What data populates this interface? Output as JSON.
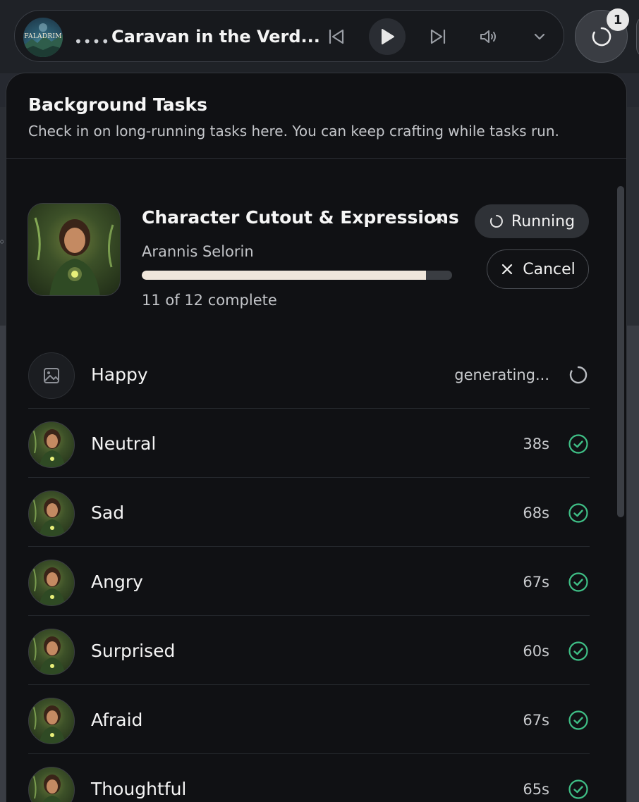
{
  "player": {
    "cover_label": "FALADRIM",
    "menu_dots": "••••",
    "track_title": "Caravan in the Verd...",
    "queue_count": "1"
  },
  "panel": {
    "title": "Background Tasks",
    "subtitle": "Check in on long-running tasks here. You can keep crafting while tasks run."
  },
  "task": {
    "title": "Character Cutout & Expressions",
    "owner": "Arannis Selorin",
    "completed": 11,
    "total": 12,
    "count_text": "11 of 12 complete",
    "status_label": "Running",
    "cancel_label": "Cancel"
  },
  "expressions": [
    {
      "name": "Happy",
      "time": "generating...",
      "state": "generating"
    },
    {
      "name": "Neutral",
      "time": "38s",
      "state": "done"
    },
    {
      "name": "Sad",
      "time": "68s",
      "state": "done"
    },
    {
      "name": "Angry",
      "time": "67s",
      "state": "done"
    },
    {
      "name": "Surprised",
      "time": "60s",
      "state": "done"
    },
    {
      "name": "Afraid",
      "time": "67s",
      "state": "done"
    },
    {
      "name": "Thoughtful",
      "time": "65s",
      "state": "done"
    }
  ],
  "colors": {
    "accent_done": "#3fbf86",
    "progress_fill": "#efe6db",
    "panel_bg": "#101114"
  },
  "icons": {
    "prev": "skip-back-icon",
    "play": "play-icon",
    "next": "skip-forward-icon",
    "volume": "volume-icon",
    "dropdown": "chevron-down-icon",
    "queue": "spinner-icon",
    "collapse": "chevron-up-icon",
    "running": "spinner-icon",
    "cancel": "close-icon",
    "done": "check-circle-icon",
    "placeholder": "image-icon"
  }
}
